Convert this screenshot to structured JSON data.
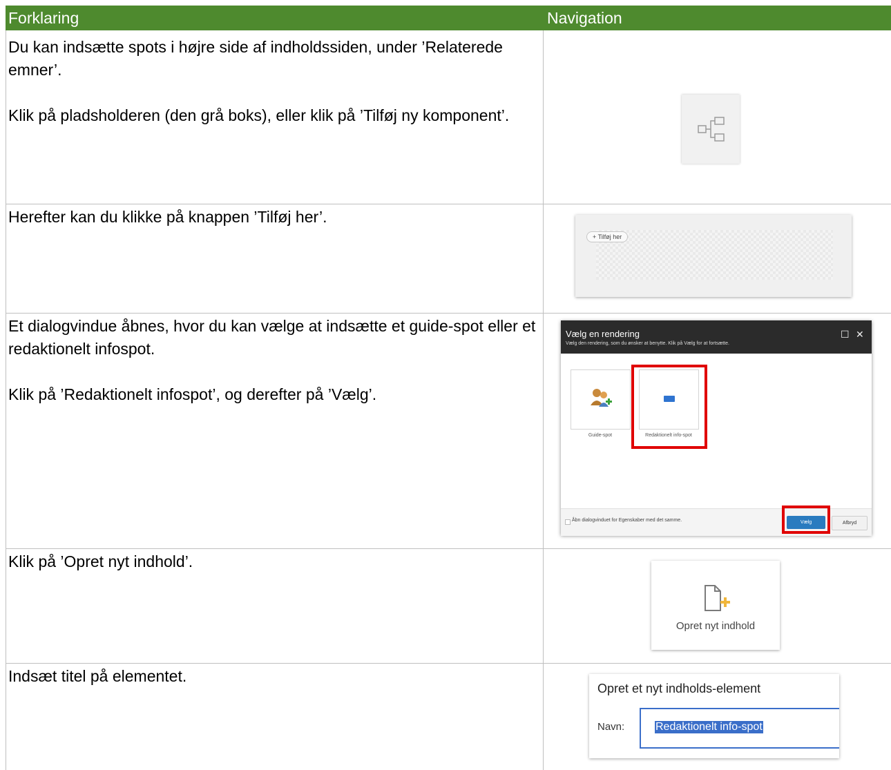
{
  "table": {
    "headers": [
      "Forklaring",
      "Navigation"
    ],
    "rows": [
      {
        "paragraphs": [
          "Du kan indsætte spots i højre side af indholdssiden, under ’Relaterede emner’.",
          "Klik på pladsholderen (den grå boks), eller klik på ’Tilføj ny komponent’."
        ]
      },
      {
        "paragraphs": [
          "Herefter kan du klikke på knappen ’Tilføj her’."
        ]
      },
      {
        "paragraphs": [
          "Et dialogvindue åbnes, hvor du kan vælge at indsætte et guide-spot eller et redaktionelt infospot.",
          "Klik på ’Redaktionelt infospot’, og derefter på ’Vælg’."
        ]
      },
      {
        "paragraphs": [
          "Klik på ’Opret nyt indhold’."
        ]
      },
      {
        "paragraphs": [
          "Indsæt titel på elementet."
        ]
      }
    ]
  },
  "screens": {
    "share_icon": "share-icon",
    "tilfoej": {
      "button_label": "+ Tilføj her"
    },
    "dialog": {
      "title": "Vælg en rendering",
      "subtitle": "Vælg den rendering, som du ønsker at benytte. Klik på Vælg for at fortsætte.",
      "maximize_icon": "☐",
      "close_icon": "✕",
      "options": [
        {
          "label": "Guide-spot",
          "icon": "users-add-icon"
        },
        {
          "label": "Redaktionelt info-spot",
          "icon": "blue-rectangle-icon"
        }
      ],
      "checkbox_label": "Åbn dialogvinduet for Egenskaber med det samme.",
      "ok_button": "Vælg",
      "cancel_button": "Afbryd",
      "highlight_color": "#e00000"
    },
    "opret": {
      "label": "Opret nyt indhold",
      "icon": "new-document-icon"
    },
    "navn": {
      "title": "Opret et nyt indholds-element",
      "field_label": "Navn:",
      "field_value": "Redaktionelt info-spot"
    }
  },
  "colors": {
    "header_bg": "#4e8a2e",
    "header_text": "#ffffff",
    "border": "#bfbfbf"
  }
}
